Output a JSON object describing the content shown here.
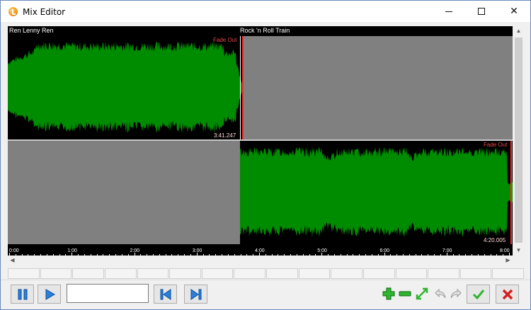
{
  "window": {
    "title": "Mix Editor"
  },
  "tracks": {
    "top_label": "Ren Lenny Ren",
    "second_label": "Rock 'n Roll Train",
    "track1": {
      "fade_label": "Fade Out",
      "time_label": "3:41.247"
    },
    "track2": {
      "fade_label": "Fade Out",
      "time_label": "4:20.005"
    }
  },
  "ruler": {
    "ticks": [
      "0:00",
      "1:00",
      "2:00",
      "3:00",
      "4:00",
      "5:00",
      "6:00",
      "7:00",
      "8:00"
    ]
  },
  "toolbar": {
    "position_value": "",
    "pause_icon": "pause-icon",
    "play_icon": "play-icon",
    "prev_icon": "skip-back-icon",
    "next_icon": "skip-forward-icon",
    "zoom_in_icon": "zoom-in-icon",
    "zoom_out_icon": "zoom-out-icon",
    "fit_icon": "fit-icon",
    "undo_icon": "undo-icon",
    "redo_icon": "redo-icon",
    "ok_icon": "check-icon",
    "cancel_icon": "cancel-icon"
  },
  "colors": {
    "waveform": "#008c00",
    "empty_track": "#808080",
    "fade_label": "#e84848",
    "cursor": "#ff2a2a"
  },
  "marker_slots": 16
}
